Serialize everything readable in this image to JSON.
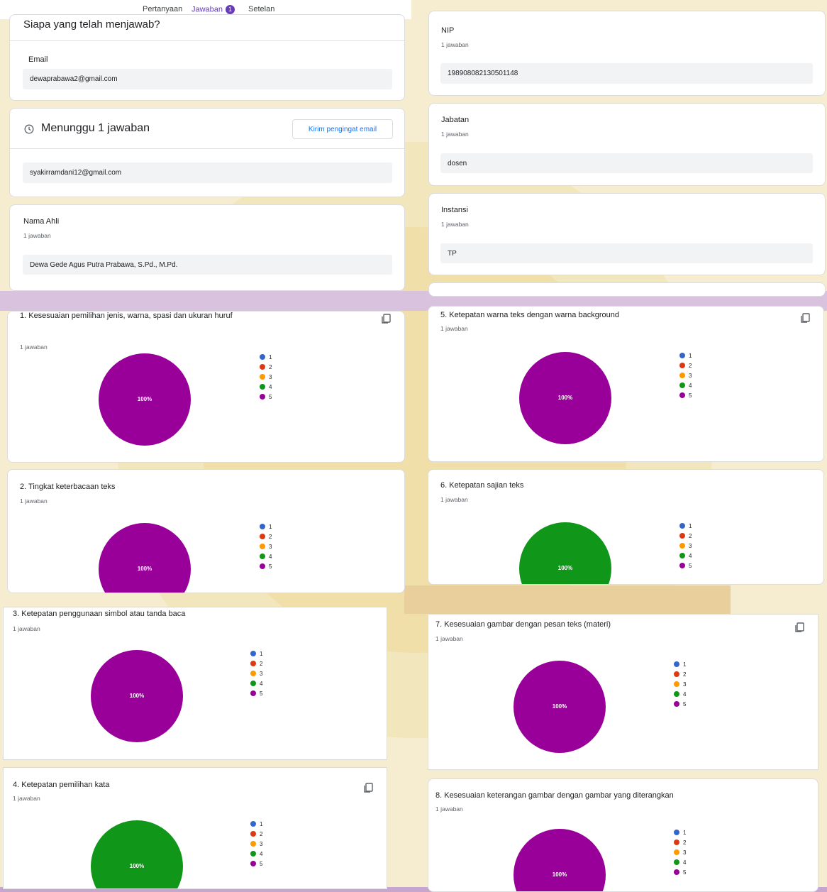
{
  "tabs": [
    {
      "label": "Pertanyaan"
    },
    {
      "label": "Jawaban",
      "badge": "1",
      "active": true
    },
    {
      "label": "Setelan"
    }
  ],
  "respondents": {
    "title": "Siapa yang telah menjawab?",
    "email_label": "Email",
    "email": "dewaprabawa2@gmail.com"
  },
  "pending": {
    "title": "Menunggu 1 jawaban",
    "button": "Kirim pengingat email",
    "email": "syakirramdani12@gmail.com"
  },
  "text_answers": [
    {
      "label": "Nama Ahli",
      "count": "1 jawaban",
      "value": "Dewa Gede Agus Putra Prabawa, S.Pd., M.Pd."
    },
    {
      "label": "NIP",
      "count": "1 jawaban",
      "value": "198908082130501148"
    },
    {
      "label": "Jabatan",
      "count": "1 jawaban",
      "value": "dosen"
    },
    {
      "label": "Instansi",
      "count": "1 jawaban",
      "value": "TP"
    }
  ],
  "legend": [
    "1",
    "2",
    "3",
    "4",
    "5"
  ],
  "colors": {
    "1": "#3366cc",
    "2": "#dc3912",
    "3": "#ff9900",
    "4": "#109618",
    "5": "#990099",
    "accent": "#673ab7",
    "link": "#1a73e8"
  },
  "questions": [
    {
      "title": "1. Kesesuaian pemilihan jenis, warna, spasi dan ukuran huruf",
      "count": "1 jawaban",
      "pct": "100%"
    },
    {
      "title": "2. Tingkat keterbacaan teks",
      "count": "1 jawaban",
      "pct": "100%"
    },
    {
      "title": "3. Ketepatan penggunaan simbol atau tanda baca",
      "count": "1 jawaban",
      "pct": "100%"
    },
    {
      "title": "4. Ketepatan pemilihan kata",
      "count": "1 jawaban",
      "pct": "100%"
    },
    {
      "title": "5. Ketepatan warna teks dengan warna background",
      "count": "1 jawaban",
      "pct": "100%"
    },
    {
      "title": "6. Ketepatan sajian teks",
      "count": "1 jawaban",
      "pct": "100%"
    },
    {
      "title": "7. Kesesuaian gambar dengan pesan teks (materi)",
      "count": "1 jawaban",
      "pct": "100%"
    },
    {
      "title": "8. Kesesuaian keterangan gambar dengan gambar yang diterangkan",
      "count": "1 jawaban",
      "pct": "100%"
    }
  ],
  "chart_data": [
    {
      "type": "pie",
      "title": "1. Kesesuaian pemilihan jenis, warna, spasi dan ukuran huruf",
      "categories": [
        "1",
        "2",
        "3",
        "4",
        "5"
      ],
      "values": [
        0,
        0,
        0,
        0,
        100
      ]
    },
    {
      "type": "pie",
      "title": "2. Tingkat keterbacaan teks",
      "categories": [
        "1",
        "2",
        "3",
        "4",
        "5"
      ],
      "values": [
        0,
        0,
        0,
        0,
        100
      ]
    },
    {
      "type": "pie",
      "title": "3. Ketepatan penggunaan simbol atau tanda baca",
      "categories": [
        "1",
        "2",
        "3",
        "4",
        "5"
      ],
      "values": [
        0,
        0,
        0,
        0,
        100
      ]
    },
    {
      "type": "pie",
      "title": "4. Ketepatan pemilihan kata",
      "categories": [
        "1",
        "2",
        "3",
        "4",
        "5"
      ],
      "values": [
        0,
        0,
        0,
        100,
        0
      ]
    },
    {
      "type": "pie",
      "title": "5. Ketepatan warna teks dengan warna background",
      "categories": [
        "1",
        "2",
        "3",
        "4",
        "5"
      ],
      "values": [
        0,
        0,
        0,
        0,
        100
      ]
    },
    {
      "type": "pie",
      "title": "6. Ketepatan sajian teks",
      "categories": [
        "1",
        "2",
        "3",
        "4",
        "5"
      ],
      "values": [
        0,
        0,
        0,
        100,
        0
      ]
    },
    {
      "type": "pie",
      "title": "7. Kesesuaian gambar dengan pesan teks (materi)",
      "categories": [
        "1",
        "2",
        "3",
        "4",
        "5"
      ],
      "values": [
        0,
        0,
        0,
        0,
        100
      ]
    },
    {
      "type": "pie",
      "title": "8. Kesesuaian keterangan gambar dengan gambar yang diterangkan",
      "categories": [
        "1",
        "2",
        "3",
        "4",
        "5"
      ],
      "values": [
        0,
        0,
        0,
        0,
        100
      ]
    }
  ]
}
